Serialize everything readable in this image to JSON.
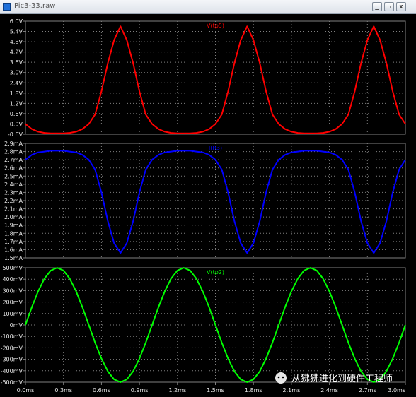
{
  "window": {
    "title": "Pic3-33.raw",
    "min_glyph": "_",
    "restore_glyph": "▫",
    "close_glyph": "x"
  },
  "watermark": {
    "text": "从狒狒进化到硬件工程师",
    "icon": "wechat-icon"
  },
  "colors": {
    "background": "#000000",
    "grid": "#7f7f7f",
    "axis_text": "#e8e8e8",
    "vtp5": "#ff0000",
    "ir3": "#0000ff",
    "vtp2": "#00ff00"
  },
  "chart_data": [
    {
      "type": "line",
      "title": "V(tp5)",
      "series": [
        {
          "name": "V(tp5)",
          "x_ms": [
            0.0,
            0.05,
            0.1,
            0.15,
            0.2,
            0.25,
            0.3,
            0.35,
            0.4,
            0.45,
            0.5,
            0.55,
            0.6,
            0.65,
            0.7,
            0.75,
            0.8,
            0.85,
            0.9,
            0.95,
            1.0,
            1.05,
            1.1,
            1.15,
            1.2,
            1.25,
            1.3,
            1.35,
            1.4,
            1.45,
            1.5,
            1.55,
            1.6,
            1.65,
            1.7,
            1.75,
            1.8,
            1.85,
            1.9,
            1.95,
            2.0,
            2.05,
            2.1,
            2.15,
            2.2,
            2.25,
            2.3,
            2.35,
            2.4,
            2.45,
            2.5,
            2.55,
            2.6,
            2.65,
            2.7,
            2.75,
            2.8,
            2.85,
            2.9,
            2.95,
            3.0
          ],
          "y": [
            0.0,
            -0.3,
            -0.45,
            -0.52,
            -0.55,
            -0.55,
            -0.55,
            -0.52,
            -0.45,
            -0.3,
            0.0,
            0.55,
            1.9,
            3.55,
            4.9,
            5.7,
            4.9,
            3.55,
            1.9,
            0.55,
            0.0,
            -0.3,
            -0.45,
            -0.52,
            -0.55,
            -0.55,
            -0.55,
            -0.52,
            -0.45,
            -0.3,
            0.0,
            0.55,
            1.9,
            3.55,
            4.9,
            5.7,
            4.9,
            3.55,
            1.9,
            0.55,
            0.0,
            -0.3,
            -0.45,
            -0.52,
            -0.55,
            -0.55,
            -0.55,
            -0.52,
            -0.45,
            -0.3,
            0.0,
            0.55,
            1.9,
            3.55,
            4.9,
            5.7,
            4.9,
            3.55,
            1.9,
            0.55,
            0.0
          ]
        }
      ],
      "yticks": [
        "-0.6V",
        "0.0V",
        "0.6V",
        "1.2V",
        "1.8V",
        "2.4V",
        "3.0V",
        "3.6V",
        "4.2V",
        "4.8V",
        "5.4V",
        "6.0V"
      ],
      "ylim": [
        -0.6,
        6.0
      ],
      "xlim": [
        0.0,
        3.0
      ],
      "grid": true
    },
    {
      "type": "line",
      "title": "I(R3)",
      "series": [
        {
          "name": "I(R3)",
          "x_ms": [
            0.0,
            0.05,
            0.1,
            0.15,
            0.2,
            0.25,
            0.3,
            0.35,
            0.4,
            0.45,
            0.5,
            0.55,
            0.6,
            0.65,
            0.7,
            0.75,
            0.8,
            0.85,
            0.9,
            0.95,
            1.0,
            1.05,
            1.1,
            1.15,
            1.2,
            1.25,
            1.3,
            1.35,
            1.4,
            1.45,
            1.5,
            1.55,
            1.6,
            1.65,
            1.7,
            1.75,
            1.8,
            1.85,
            1.9,
            1.95,
            2.0,
            2.05,
            2.1,
            2.15,
            2.2,
            2.25,
            2.3,
            2.35,
            2.4,
            2.45,
            2.5,
            2.55,
            2.6,
            2.65,
            2.7,
            2.75,
            2.8,
            2.85,
            2.9,
            2.95,
            3.0
          ],
          "y": [
            2.7,
            2.76,
            2.79,
            2.8,
            2.81,
            2.81,
            2.81,
            2.8,
            2.79,
            2.76,
            2.7,
            2.58,
            2.3,
            1.95,
            1.68,
            1.56,
            1.68,
            1.95,
            2.3,
            2.58,
            2.7,
            2.76,
            2.79,
            2.8,
            2.81,
            2.81,
            2.81,
            2.8,
            2.79,
            2.76,
            2.7,
            2.58,
            2.3,
            1.95,
            1.68,
            1.56,
            1.68,
            1.95,
            2.3,
            2.58,
            2.7,
            2.76,
            2.79,
            2.8,
            2.81,
            2.81,
            2.81,
            2.8,
            2.79,
            2.76,
            2.7,
            2.58,
            2.3,
            1.95,
            1.68,
            1.56,
            1.68,
            1.95,
            2.3,
            2.58,
            2.7
          ]
        }
      ],
      "yticks": [
        "1.5mA",
        "1.6mA",
        "1.7mA",
        "1.8mA",
        "1.9mA",
        "2.0mA",
        "2.1mA",
        "2.2mA",
        "2.3mA",
        "2.4mA",
        "2.5mA",
        "2.6mA",
        "2.7mA",
        "2.8mA",
        "2.9mA"
      ],
      "ylim": [
        1.5,
        2.9
      ],
      "xlim": [
        0.0,
        3.0
      ],
      "grid": true
    },
    {
      "type": "line",
      "title": "V(tp2)",
      "series": [
        {
          "name": "V(tp2)",
          "x_ms": [
            0.0,
            0.05,
            0.1,
            0.15,
            0.2,
            0.25,
            0.3,
            0.35,
            0.4,
            0.45,
            0.5,
            0.55,
            0.6,
            0.65,
            0.7,
            0.75,
            0.8,
            0.85,
            0.9,
            0.95,
            1.0,
            1.05,
            1.1,
            1.15,
            1.2,
            1.25,
            1.3,
            1.35,
            1.4,
            1.45,
            1.5,
            1.55,
            1.6,
            1.65,
            1.7,
            1.75,
            1.8,
            1.85,
            1.9,
            1.95,
            2.0,
            2.05,
            2.1,
            2.15,
            2.2,
            2.25,
            2.3,
            2.35,
            2.4,
            2.45,
            2.5,
            2.55,
            2.6,
            2.65,
            2.7,
            2.75,
            2.8,
            2.85,
            2.9,
            2.95,
            3.0
          ],
          "y": [
            0,
            155,
            294,
            405,
            476,
            500,
            476,
            405,
            294,
            155,
            0,
            -155,
            -294,
            -405,
            -476,
            -500,
            -476,
            -405,
            -294,
            -155,
            0,
            155,
            294,
            405,
            476,
            500,
            476,
            405,
            294,
            155,
            0,
            -155,
            -294,
            -405,
            -476,
            -500,
            -476,
            -405,
            -294,
            -155,
            0,
            155,
            294,
            405,
            476,
            500,
            476,
            405,
            294,
            155,
            0,
            -155,
            -294,
            -405,
            -476,
            -500,
            -476,
            -405,
            -294,
            -155,
            0
          ]
        }
      ],
      "yticks": [
        "-500mV",
        "-400mV",
        "-300mV",
        "-200mV",
        "-100mV",
        "0mV",
        "100mV",
        "200mV",
        "300mV",
        "400mV",
        "500mV"
      ],
      "ylim": [
        -500,
        500
      ],
      "xlim": [
        0.0,
        3.0
      ],
      "grid": true
    }
  ],
  "xticks": [
    "0.0ms",
    "0.3ms",
    "0.6ms",
    "0.9ms",
    "1.2ms",
    "1.5ms",
    "1.8ms",
    "2.1ms",
    "2.4ms",
    "2.7ms",
    "3.0ms"
  ]
}
